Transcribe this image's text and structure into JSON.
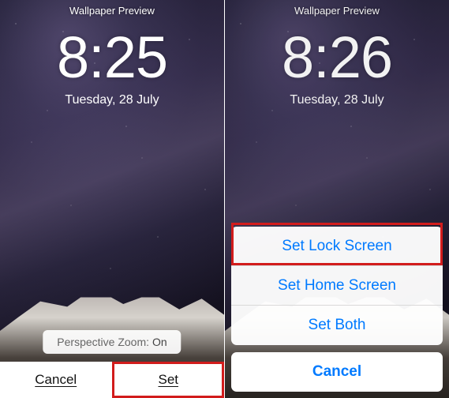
{
  "left": {
    "title": "Wallpaper Preview",
    "time": "8:25",
    "date": "Tuesday, 28 July",
    "perspective_label": "Perspective Zoom:",
    "perspective_value": "On",
    "toolbar": {
      "cancel": "Cancel",
      "set": "Set"
    }
  },
  "right": {
    "title": "Wallpaper Preview",
    "time": "8:26",
    "date": "Tuesday, 28 July",
    "sheet": {
      "set_lock": "Set Lock Screen",
      "set_home": "Set Home Screen",
      "set_both": "Set Both",
      "cancel": "Cancel"
    }
  }
}
